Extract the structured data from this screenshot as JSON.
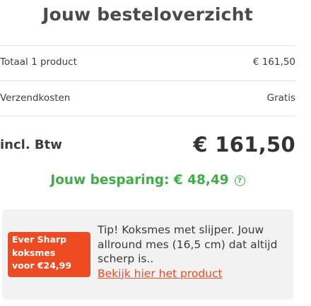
{
  "header": {
    "title": "Jouw besteloverzicht"
  },
  "summary": {
    "subtotal_label": "Totaal 1 product",
    "subtotal_value": "€ 161,50",
    "shipping_label": "Verzendkosten",
    "shipping_value": "Gratis",
    "total_label": "incl. Btw",
    "total_value": "€ 161,50"
  },
  "savings": {
    "text": "Jouw besparing: € 48,49",
    "help_icon": "question-circle-icon",
    "help_glyph": "?"
  },
  "tip": {
    "badge_lines": [
      "Ever Sharp",
      "koksmes",
      "voor €24,99"
    ],
    "text": "Tip! Koksmes met slijper. Jouw allround mes (16,5 cm) dat altijd scherp is..",
    "link_text": "Bekijk hier het product"
  },
  "colors": {
    "accent_green": "#3fae49",
    "accent_orange": "#ef4b22",
    "tip_background": "#f2f2f2"
  }
}
